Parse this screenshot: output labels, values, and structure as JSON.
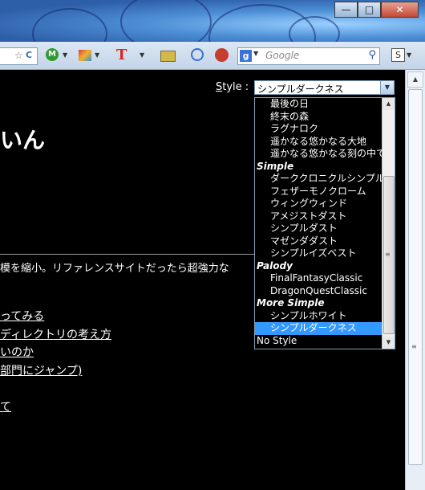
{
  "window": {
    "buttons": {
      "minimize": "—",
      "maximize": "□",
      "close": "✕"
    }
  },
  "toolbar": {
    "star_icon": "☆",
    "reload_icon": "C",
    "m_icon": "M",
    "t_icon": "T",
    "google_icon": "g",
    "s_icon": "S",
    "search": {
      "placeholder": "Google",
      "icon": "search-icon"
    },
    "dropdown_glyph": "▼"
  },
  "page": {
    "style_label_u": "S",
    "style_label_rest": "tyle :",
    "select_value": "シンプルダークネス",
    "heading": "いん",
    "paragraph": "模を縮小。リファレンスサイトだったら超強力な",
    "links": [
      "ってみる",
      "ディレクトリの考え方",
      "いのか",
      "部門にジャンプ)",
      "て"
    ]
  },
  "dropdown": {
    "items": [
      {
        "type": "option",
        "label": "最後の日"
      },
      {
        "type": "option",
        "label": "終末の森"
      },
      {
        "type": "option",
        "label": "ラグナロク"
      },
      {
        "type": "option",
        "label": "遥かなる悠かなる大地"
      },
      {
        "type": "option",
        "label": "遥かなる悠かなる刻の中で"
      },
      {
        "type": "group",
        "label": "Simple"
      },
      {
        "type": "option",
        "label": "ダーククロニクルシンプル"
      },
      {
        "type": "option",
        "label": "フェザーモノクローム"
      },
      {
        "type": "option",
        "label": "ウィングウィンド"
      },
      {
        "type": "option",
        "label": "アメジストダスト"
      },
      {
        "type": "option",
        "label": "シンプルダスト"
      },
      {
        "type": "option",
        "label": "マゼンダダスト"
      },
      {
        "type": "option",
        "label": "シンプルイズベスト"
      },
      {
        "type": "group",
        "label": "Palody"
      },
      {
        "type": "option",
        "label": "FinalFantasyClassic"
      },
      {
        "type": "option",
        "label": "DragonQuestClassic"
      },
      {
        "type": "group",
        "label": "More Simple"
      },
      {
        "type": "option",
        "label": "シンプルホワイト"
      },
      {
        "type": "option",
        "label": "シンプルダークネス",
        "selected": true
      },
      {
        "type": "option",
        "label": "No Style",
        "none": true
      }
    ],
    "selection_color": "#3399ff"
  },
  "colors": {
    "background": "#000000",
    "text": "#ffffff",
    "selection": "#3399ff"
  }
}
